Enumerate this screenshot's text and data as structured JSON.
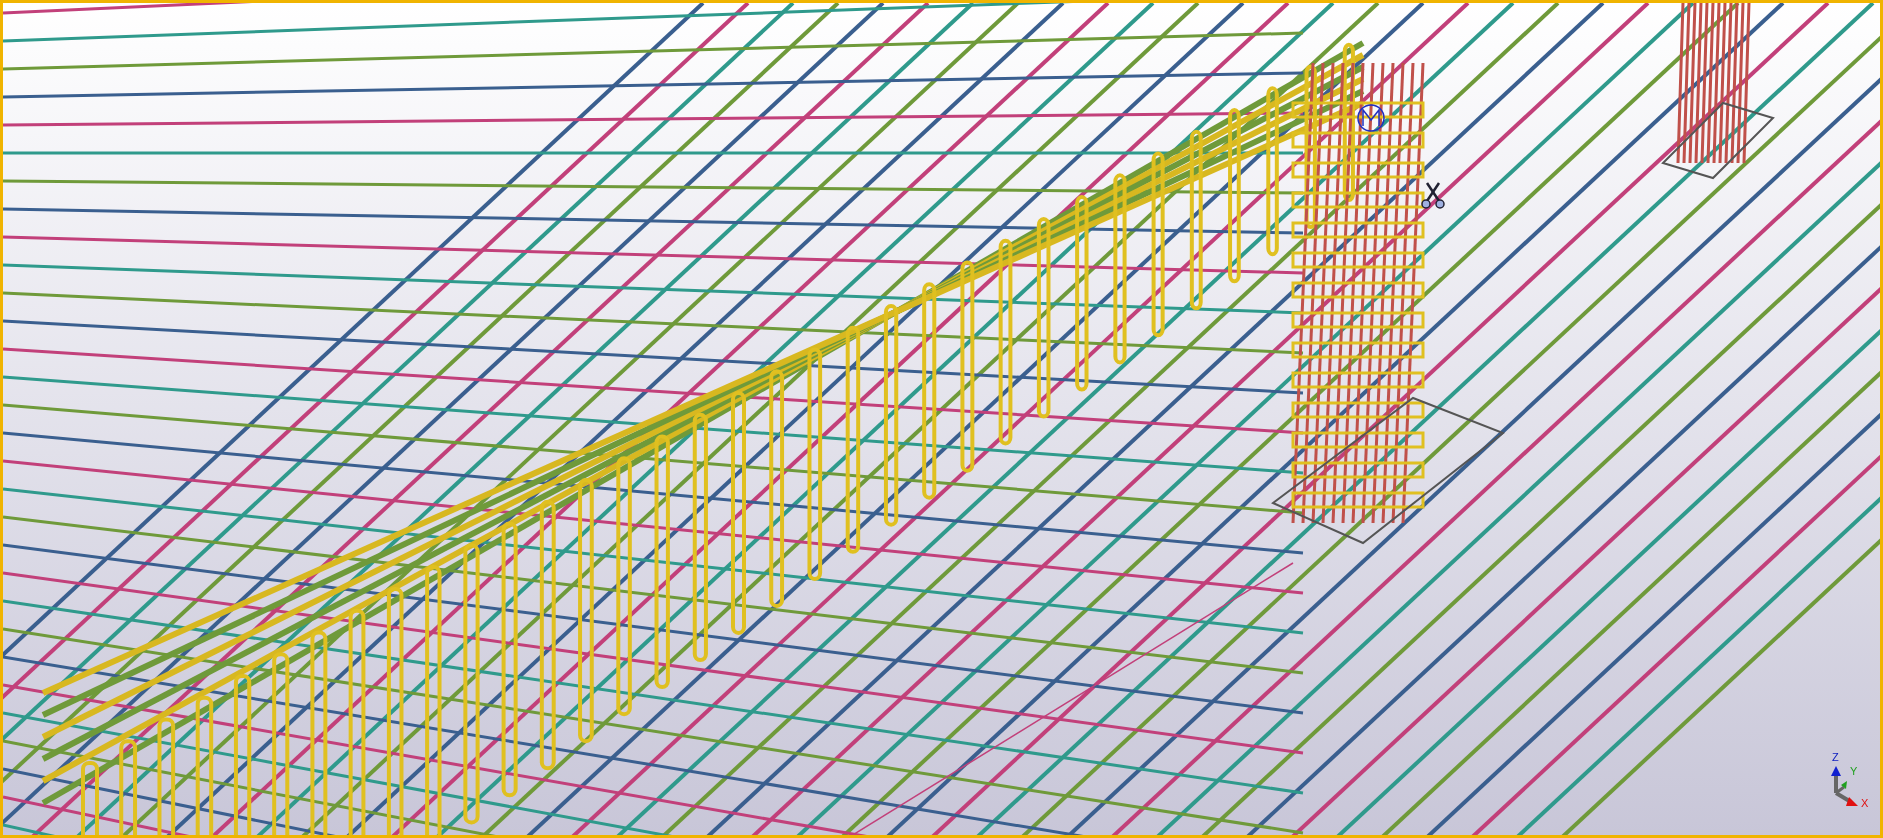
{
  "viewport": {
    "axis_indicator": {
      "z_label": "Z",
      "y_label": "Y",
      "x_label": "X"
    }
  }
}
